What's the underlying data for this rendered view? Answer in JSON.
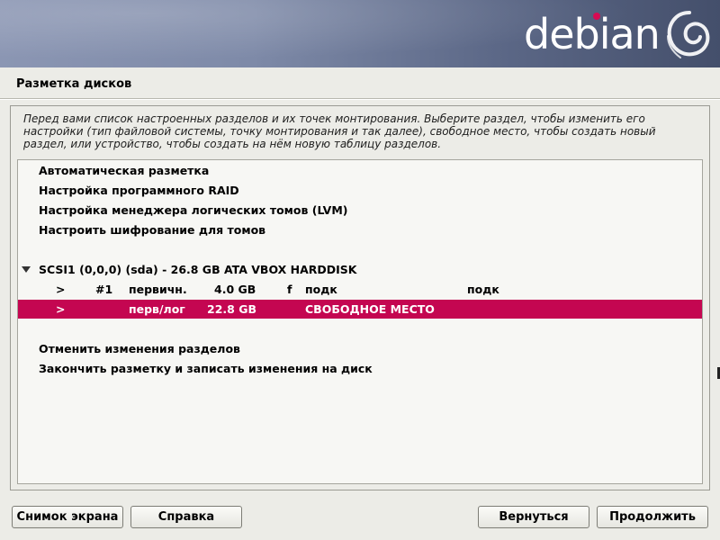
{
  "brand": {
    "logo_text": "debian",
    "colors": {
      "accent": "#d70a53",
      "selection": "#c40651",
      "banner": "#7e8aa8"
    }
  },
  "page": {
    "title": "Разметка дисков",
    "description": "Перед вами список настроенных разделов и их точек монтирования. Выберите раздел, чтобы изменить его настройки (тип файловой системы, точку монтирования и так далее), свободное место, чтобы создать новый раздел, или устройство, чтобы создать на нём новую таблицу разделов."
  },
  "menu": {
    "actions": [
      "Автоматическая разметка",
      "Настройка программного RAID",
      "Настройка менеджера логических томов (LVM)",
      "Настроить шифрование для томов"
    ],
    "disk": {
      "expander_icon": "triangle-down-icon",
      "label": "SCSI1 (0,0,0) (sda) - 26.8 GB ATA VBOX HARDDISK"
    },
    "partitions": [
      {
        "marker": ">",
        "number": "#1",
        "type": "первичн.",
        "size": "4.0 GB",
        "flag": "f",
        "fs": "подк",
        "mount": "подк",
        "selected": false
      },
      {
        "marker": ">",
        "number": "",
        "type": "перв/лог",
        "size": "22.8 GB",
        "flag": "",
        "fs": "СВОБОДНОЕ МЕСТО",
        "mount": "",
        "selected": true
      }
    ],
    "footer_actions": [
      "Отменить изменения разделов",
      "Закончить разметку и записать изменения на диск"
    ]
  },
  "buttons": {
    "screenshot": "Снимок экрана",
    "help": "Справка",
    "back": "Вернуться",
    "continue": "Продолжить"
  }
}
